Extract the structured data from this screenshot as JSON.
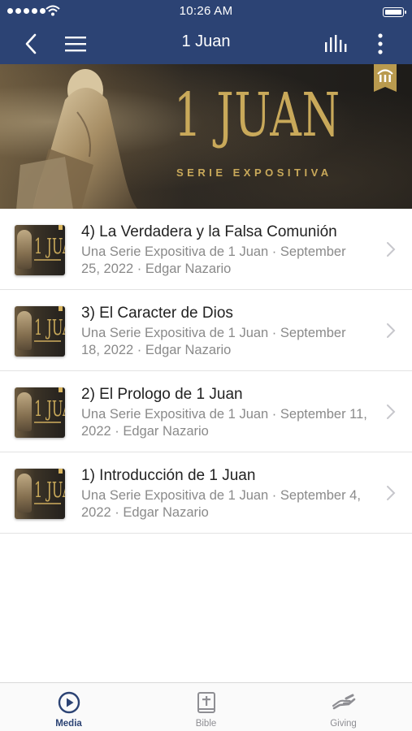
{
  "status_bar": {
    "time": "10:26 AM"
  },
  "header": {
    "title": "1 Juan",
    "back_icon": "chevron-left-icon",
    "menu_icon": "hamburger-icon",
    "stats_icon": "bar-chart-icon",
    "more_icon": "more-vertical-icon"
  },
  "banner": {
    "title": "1 JUAN",
    "subtitle": "SERIE EXPOSITIVA"
  },
  "thumb": {
    "title": "1 JUAN"
  },
  "sermons": [
    {
      "title": "4) La Verdadera y la Falsa Comunión",
      "meta": "Una Serie Expositiva de 1 Juan · September 25, 2022 · Edgar Nazario"
    },
    {
      "title": "3) El Caracter de Dios",
      "meta": "Una Serie Expositiva de 1 Juan · September 18, 2022 · Edgar Nazario"
    },
    {
      "title": "2) El Prologo de 1 Juan",
      "meta": "Una Serie Expositiva de 1 Juan · September 11, 2022 · Edgar Nazario"
    },
    {
      "title": "1) Introducción de 1 Juan",
      "meta": "Una Serie Expositiva de 1 Juan · September 4, 2022 · Edgar Nazario"
    }
  ],
  "tabs": [
    {
      "label": "Media",
      "icon": "play-circle-icon",
      "active": true
    },
    {
      "label": "Bible",
      "icon": "bible-icon",
      "active": false
    },
    {
      "label": "Giving",
      "icon": "giving-hand-icon",
      "active": false
    }
  ],
  "colors": {
    "nav": "#2c4374",
    "gold": "#c9a95a",
    "muted": "#8a8a8a"
  }
}
